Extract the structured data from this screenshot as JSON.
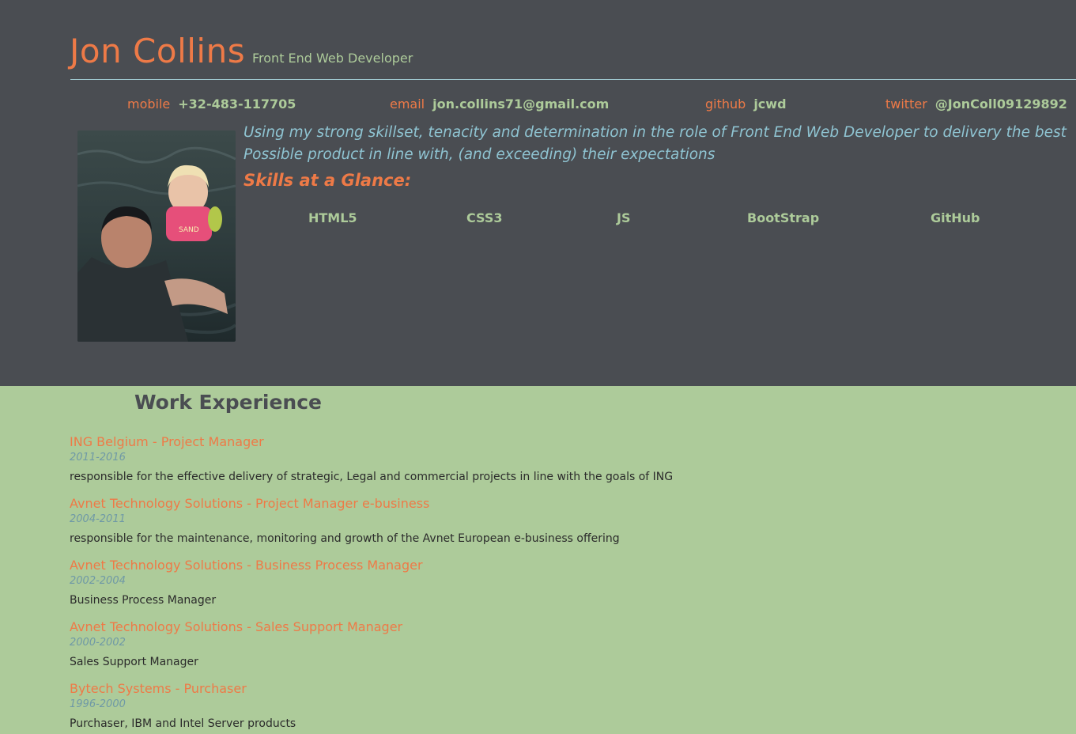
{
  "header": {
    "name": "Jon Collins",
    "role": "Front End Web Developer"
  },
  "contacts": [
    {
      "label": "mobile",
      "value": "+32-483-117705"
    },
    {
      "label": "email",
      "value": "jon.collins71@gmail.com"
    },
    {
      "label": "github",
      "value": "jcwd"
    },
    {
      "label": "twitter",
      "value": "@JonColl09129892"
    }
  ],
  "intro": " Using my strong skillset, tenacity and determination in the role of Front End Web Developer to delivery the best Possible product in line with, (and exceeding) their expectations",
  "skills": {
    "title": "Skills at a Glance:",
    "items": [
      "HTML5",
      "CSS3",
      "JS",
      "BootStrap",
      "GitHub"
    ]
  },
  "work": {
    "title": "Work Experience",
    "jobs": [
      {
        "title": "ING Belgium - Project Manager",
        "dates": "2011-2016",
        "desc": "responsible for the effective delivery of strategic, Legal and commercial projects in line with the goals of ING"
      },
      {
        "title": "Avnet Technology Solutions - Project Manager e-business",
        "dates": "2004-2011",
        "desc": "responsible for the maintenance, monitoring and growth of the Avnet European e-business offering"
      },
      {
        "title": "Avnet Technology Solutions - Business Process Manager",
        "dates": "2002-2004",
        "desc": "Business Process Manager"
      },
      {
        "title": "Avnet Technology Solutions - Sales Support Manager",
        "dates": "2000-2002",
        "desc": "Sales Support Manager"
      },
      {
        "title": "Bytech Systems - Purchaser",
        "dates": "1996-2000",
        "desc": "Purchaser, IBM and Intel Server products"
      }
    ]
  },
  "colors": {
    "header_bg": "#4a4d52",
    "page_bg": "#adcb9a",
    "accent": "#ee7a47",
    "intro_text": "#8fc4d2"
  }
}
